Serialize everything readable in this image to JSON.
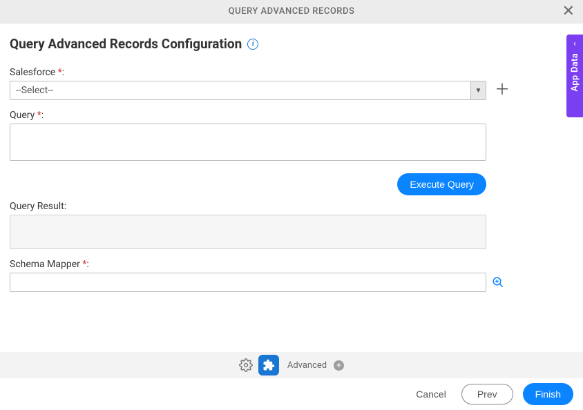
{
  "header": {
    "title": "QUERY ADVANCED RECORDS"
  },
  "page": {
    "title": "Query Advanced Records Configuration"
  },
  "fields": {
    "salesforce_label": "Salesforce",
    "salesforce_placeholder": "--Select--",
    "query_label": "Query",
    "query_value": "",
    "execute_label": "Execute Query",
    "result_label": "Query Result:",
    "schema_label": "Schema Mapper",
    "schema_value": ""
  },
  "toolbar": {
    "advanced_label": "Advanced"
  },
  "footer": {
    "cancel": "Cancel",
    "prev": "Prev",
    "finish": "Finish"
  },
  "sidepanel": {
    "label": "App Data"
  }
}
